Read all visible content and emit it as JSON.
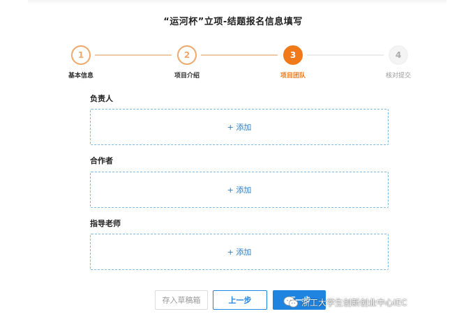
{
  "page": {
    "title": "“运河杯”立项-结题报名信息填写"
  },
  "stepper": {
    "steps": [
      {
        "number": "1",
        "label": "基本信息",
        "state": "done"
      },
      {
        "number": "2",
        "label": "项目介绍",
        "state": "done"
      },
      {
        "number": "3",
        "label": "项目团队",
        "state": "active"
      },
      {
        "number": "4",
        "label": "核对提交",
        "state": "todo"
      }
    ],
    "colors": {
      "done": "#f0a76a",
      "active": "#f07a1a",
      "todo": "#aaaaaa"
    }
  },
  "sections": [
    {
      "label": "负责人",
      "add_label": "+ 添加"
    },
    {
      "label": "合作者",
      "add_label": "+ 添加"
    },
    {
      "label": "指导老师",
      "add_label": "+ 添加"
    }
  ],
  "buttons": {
    "draft_label": "存入草稿箱",
    "prev_label": "上一步",
    "next_label": "下一步"
  },
  "watermark": {
    "icon": "wechat-icon",
    "text": "浙工大学生创新创业中心IEC"
  },
  "colors": {
    "accent_orange": "#f07a1a",
    "accent_blue": "#1f84e0",
    "dashed_border": "#7fb9e6"
  }
}
